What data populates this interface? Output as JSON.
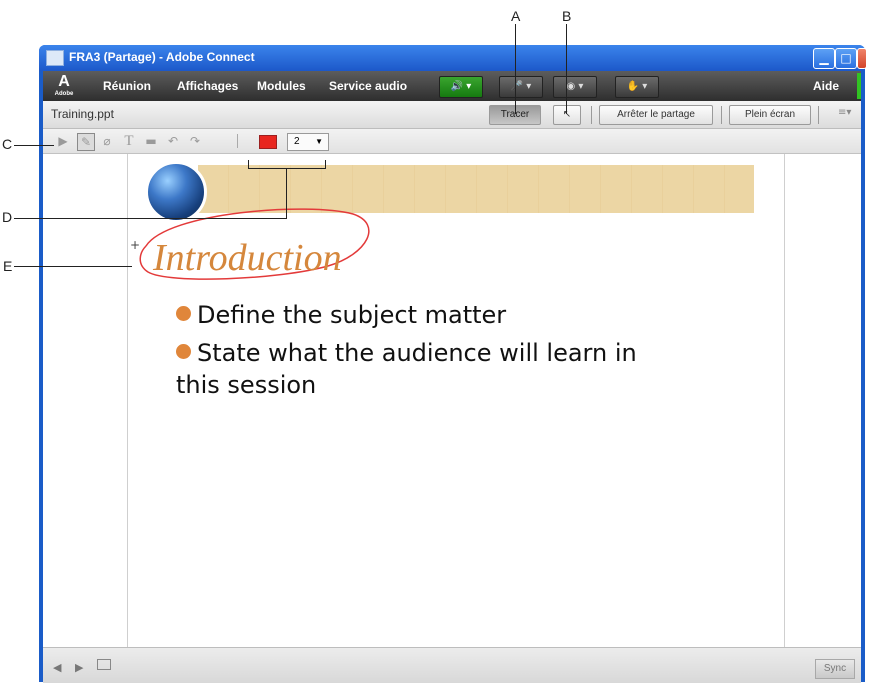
{
  "callouts": {
    "a": "A",
    "b": "B",
    "c": "C",
    "d": "D",
    "e": "E"
  },
  "window": {
    "title": "FRA3 (Partage) - Adobe Connect",
    "min_icon": "minimize-icon",
    "max_icon": "maximize-icon",
    "close_icon": "close-icon"
  },
  "menubar": {
    "logo": "Adobe",
    "items": [
      "Réunion",
      "Affichages",
      "Modules",
      "Service audio"
    ],
    "help": "Aide"
  },
  "pod": {
    "title": "Training.ppt",
    "tracer": "Tracer",
    "stop_share": "Arrêter le partage",
    "fullscreen": "Plein écran"
  },
  "draw_toolbar": {
    "color": "#e8261f",
    "size": "2"
  },
  "slide": {
    "title": "Introduction",
    "bullets": [
      "Define the subject matter",
      "State what the audience will learn in this session"
    ],
    "bullet2_line1": "State what the audience will learn in",
    "bullet2_line2": "this session"
  },
  "status": {
    "sync": "Sync"
  }
}
